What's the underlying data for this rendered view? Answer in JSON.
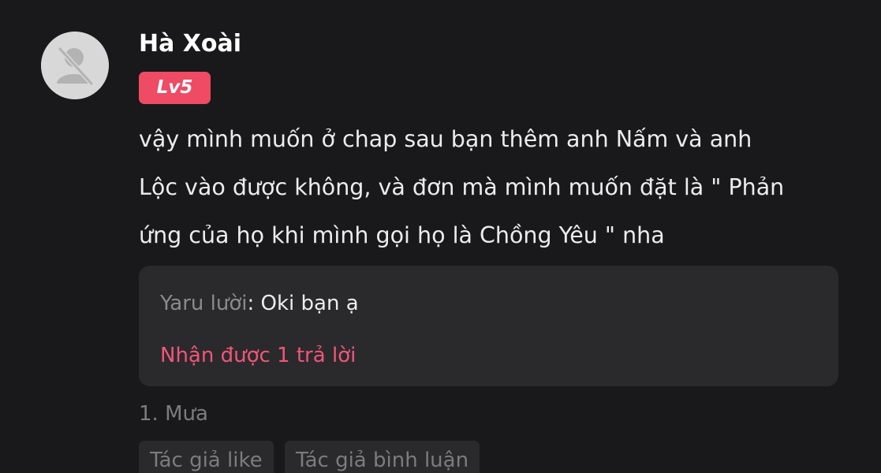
{
  "comment": {
    "author": "Hà Xoài",
    "level": "Lv5",
    "text_lines": [
      "vậy mình muốn ở chap sau bạn thêm anh Nấm và anh",
      "Lộc vào được không, và đơn mà mình muốn đặt là \" Phản",
      "ứng của họ khi mình gọi họ là Chồng Yêu \" nha"
    ],
    "avatar_icon": "user-placeholder-icon"
  },
  "reply_preview": {
    "author": "Yaru lười",
    "separator": ": ",
    "text": "Oki bạn ạ",
    "count_label": "Nhận được 1 trả lời"
  },
  "list_item": "1. Mưa",
  "tags": {
    "author_like": "Tác giả like",
    "author_comment": "Tác giả bình luận"
  },
  "colors": {
    "background": "#19191b",
    "badge": "#ef4b64",
    "reply_link": "#f2557a",
    "reply_box": "#2a2a2c"
  }
}
